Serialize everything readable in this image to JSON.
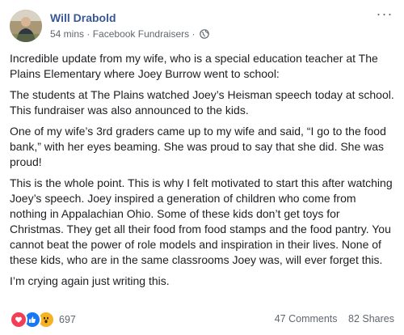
{
  "post": {
    "author": "Will Drabold",
    "time": "54 mins",
    "separator": "·",
    "source": "Facebook Fundraisers",
    "separator2": "·",
    "more_label": "···",
    "paragraphs": [
      "Incredible update from my wife, who is a special education teacher at The Plains Elementary where Joey Burrow went to school:",
      "The students at The Plains watched Joey’s Heisman speech today at school. This fundraiser was also announced to the kids.",
      "One of my wife’s 3rd graders came up to my wife and said, “I go to the food bank,” with her eyes beaming. She was proud to say that she did. She was proud!",
      "This is the whole point. This is why I felt motivated to start this after watching Joey’s speech. Joey inspired a generation of children who come from nothing in Appalachian Ohio. Some of these kids don’t get toys for Christmas. They get all their food from food stamps and the food pantry. You cannot beat the power of role models and inspiration in their lives. None of these kids, who are in the same classrooms Joey was, will ever forget this.",
      "I’m crying again just writing this."
    ]
  },
  "footer": {
    "reaction_icons": [
      "heart-icon",
      "thumbs-up-icon",
      "wow-icon"
    ],
    "reaction_count": "697",
    "comments": "47 Comments",
    "shares": "82 Shares"
  },
  "colors": {
    "author_link": "#385898",
    "like": "#1877f2",
    "love": "#f33e58",
    "wow": "#f7b125",
    "secondary_text": "#606770"
  }
}
